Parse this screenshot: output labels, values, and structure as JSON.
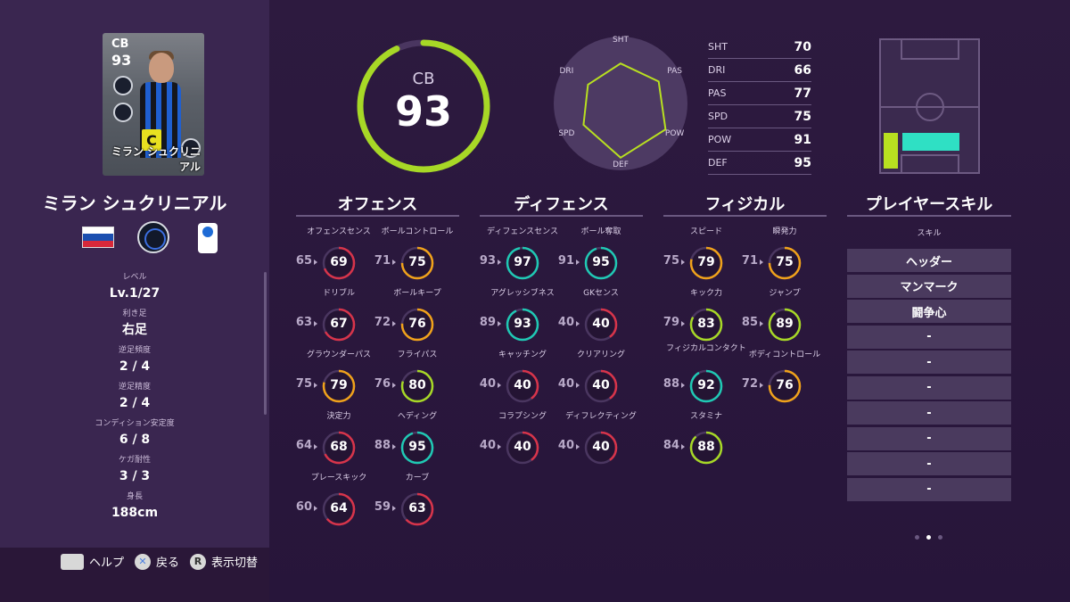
{
  "player": {
    "name": "ミラン シュクリニアル",
    "card_name": "ミラン シュクリニアル",
    "position": "CB",
    "overall": "93",
    "captain_mark": "C"
  },
  "profile": [
    {
      "label": "レベル",
      "value": "Lv.1/27"
    },
    {
      "label": "利き足",
      "value": "右足"
    },
    {
      "label": "逆足頻度",
      "value": "2 / 4"
    },
    {
      "label": "逆足精度",
      "value": "2 / 4"
    },
    {
      "label": "コンディション安定度",
      "value": "6 / 8"
    },
    {
      "label": "ケガ耐性",
      "value": "3 / 3"
    },
    {
      "label": "身長",
      "value": "188cm"
    }
  ],
  "overall_ring_fraction": 0.93,
  "radar": {
    "labels": [
      "SHT",
      "PAS",
      "POW",
      "DEF",
      "SPD",
      "DRI"
    ]
  },
  "stats_table": [
    {
      "label": "SHT",
      "value": "70"
    },
    {
      "label": "DRI",
      "value": "66"
    },
    {
      "label": "PAS",
      "value": "77"
    },
    {
      "label": "SPD",
      "value": "75"
    },
    {
      "label": "POW",
      "value": "91"
    },
    {
      "label": "DEF",
      "value": "95"
    }
  ],
  "categories": {
    "offense": "オフェンス",
    "defense": "ディフェンス",
    "physical": "フィジカル",
    "skills": "プレイヤースキル"
  },
  "offense": [
    {
      "name": "オフェンスセンス",
      "base": "65",
      "value": "69"
    },
    {
      "name": "ボールコントロール",
      "base": "71",
      "value": "75"
    },
    {
      "name": "ドリブル",
      "base": "63",
      "value": "67"
    },
    {
      "name": "ボールキープ",
      "base": "72",
      "value": "76"
    },
    {
      "name": "グラウンダーパス",
      "base": "75",
      "value": "79"
    },
    {
      "name": "フライパス",
      "base": "76",
      "value": "80"
    },
    {
      "name": "決定力",
      "base": "64",
      "value": "68"
    },
    {
      "name": "ヘディング",
      "base": "88",
      "value": "95"
    },
    {
      "name": "プレースキック",
      "base": "60",
      "value": "64"
    },
    {
      "name": "カーブ",
      "base": "59",
      "value": "63"
    }
  ],
  "defense": [
    {
      "name": "ディフェンスセンス",
      "base": "93",
      "value": "97"
    },
    {
      "name": "ボール奪取",
      "base": "91",
      "value": "95"
    },
    {
      "name": "アグレッシブネス",
      "base": "89",
      "value": "93"
    },
    {
      "name": "GKセンス",
      "base": "40",
      "value": "40"
    },
    {
      "name": "キャッチング",
      "base": "40",
      "value": "40"
    },
    {
      "name": "クリアリング",
      "base": "40",
      "value": "40"
    },
    {
      "name": "コラプシング",
      "base": "40",
      "value": "40"
    },
    {
      "name": "ディフレクティング",
      "base": "40",
      "value": "40"
    }
  ],
  "physical": [
    {
      "name": "スピード",
      "base": "75",
      "value": "79"
    },
    {
      "name": "瞬発力",
      "base": "71",
      "value": "75"
    },
    {
      "name": "キック力",
      "base": "79",
      "value": "83"
    },
    {
      "name": "ジャンプ",
      "base": "85",
      "value": "89"
    },
    {
      "name": "フィジカルコンタクト",
      "base": "88",
      "value": "92"
    },
    {
      "name": "ボディコントロール",
      "base": "72",
      "value": "76"
    },
    {
      "name": "スタミナ",
      "base": "84",
      "value": "88"
    }
  ],
  "skills": {
    "sub_label": "スキル",
    "list": [
      "ヘッダー",
      "マンマーク",
      "闘争心",
      "-",
      "-",
      "-",
      "-",
      "-",
      "-",
      "-"
    ]
  },
  "footer": {
    "help": "ヘルプ",
    "back": "戻る",
    "toggle": "表示切替",
    "cross_symbol": "✕",
    "r_symbol": "R"
  },
  "colors": {
    "high": "#1fc9b4",
    "upper": "#a7d826",
    "mid": "#f0a21a",
    "low": "#d8344a",
    "ring_track": "#4a3660"
  }
}
